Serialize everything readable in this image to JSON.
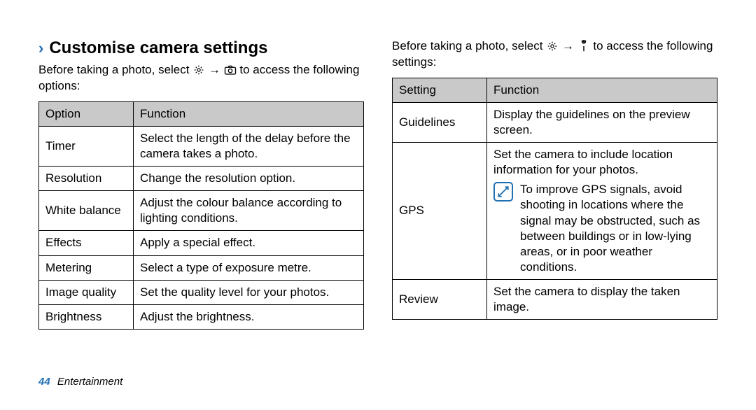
{
  "heading": "Customise camera settings",
  "intro_left_pre": "Before taking a photo, select ",
  "intro_left_post": " to access the following options:",
  "intro_right_pre": "Before taking a photo, select ",
  "intro_right_post": " to access the following settings:",
  "arrow": "→",
  "table_left": {
    "headers": [
      "Option",
      "Function"
    ],
    "rows": [
      [
        "Timer",
        "Select the length of the delay before the camera takes a photo."
      ],
      [
        "Resolution",
        "Change the resolution option."
      ],
      [
        "White balance",
        "Adjust the colour balance according to lighting conditions."
      ],
      [
        "Effects",
        "Apply a special effect."
      ],
      [
        "Metering",
        "Select a type of exposure metre."
      ],
      [
        "Image quality",
        "Set the quality level for your photos."
      ],
      [
        "Brightness",
        "Adjust the brightness."
      ]
    ]
  },
  "table_right": {
    "headers": [
      "Setting",
      "Function"
    ],
    "rows": [
      {
        "label": "Guidelines",
        "text": "Display the guidelines on the preview screen."
      },
      {
        "label": "GPS",
        "text": "Set the camera to include location information for your photos.",
        "note": "To improve GPS signals, avoid shooting in locations where the signal may be obstructed, such as between buildings or in low-lying areas, or in poor weather conditions."
      },
      {
        "label": "Review",
        "text": "Set the camera to display the taken image."
      }
    ]
  },
  "footer": {
    "page": "44",
    "section": "Entertainment"
  }
}
